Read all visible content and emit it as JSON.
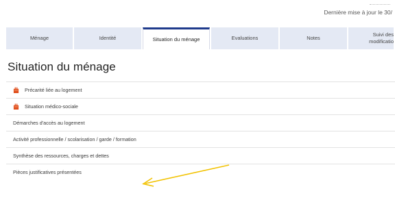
{
  "header": {
    "last_update": "Dernière mise à jour le 30/"
  },
  "tabs": [
    {
      "label": "Ménage",
      "active": false
    },
    {
      "label": "Identité",
      "active": false
    },
    {
      "label": "Situation du ménage",
      "active": true
    },
    {
      "label": "Evaluations",
      "active": false
    },
    {
      "label": "Notes",
      "active": false
    },
    {
      "label": "Suivi des modificatio",
      "active": false
    }
  ],
  "page": {
    "title": "Situation du ménage"
  },
  "sections": [
    {
      "label": "Précarité liée au logement",
      "icon": "warning-icon"
    },
    {
      "label": "Situation médico-sociale",
      "icon": "warning-icon"
    },
    {
      "label": "Démarches d'accès au logement"
    },
    {
      "label": "Activité professionnelle / scolarisation / garde / formation"
    },
    {
      "label": "Synthèse des ressources, charges et dettes"
    },
    {
      "label": "Pièces justificatives présentées"
    }
  ],
  "colors": {
    "accent": "#1f3b8c",
    "tab_bg": "#e4e9f4",
    "warning": "#e0501e",
    "annotation_arrow": "#f2c200"
  }
}
